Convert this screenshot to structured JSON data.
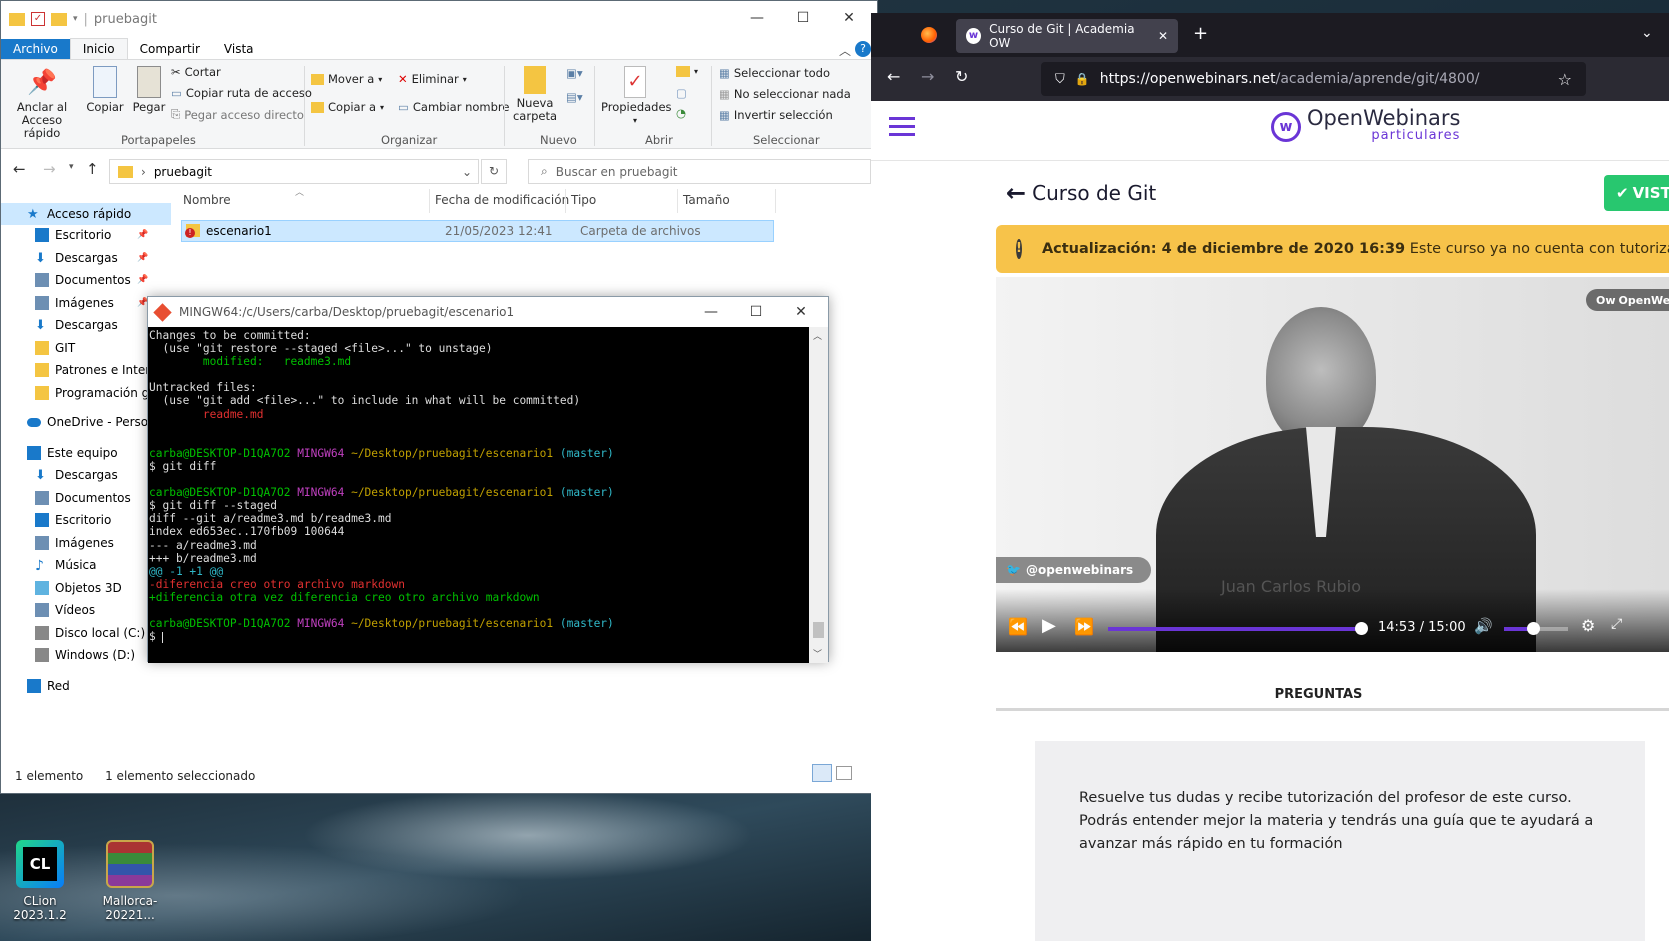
{
  "explorer": {
    "title": "pruebagit",
    "ribbon_tabs": [
      "Archivo",
      "Inicio",
      "Compartir",
      "Vista"
    ],
    "ribbon": {
      "pin": "Anclar al\nAcceso rápido",
      "pin_l1": "Anclar al",
      "pin_l2": "Acceso rápido",
      "copy": "Copiar",
      "paste": "Pegar",
      "cut": "Cortar",
      "copy_path": "Copiar ruta de acceso",
      "paste_shortcut": "Pegar acceso directo",
      "group_clipboard": "Portapapeles",
      "move_to": "Mover a",
      "copy_to": "Copiar a",
      "delete": "Eliminar",
      "rename": "Cambiar nombre",
      "group_organize": "Organizar",
      "new_folder_l1": "Nueva",
      "new_folder_l2": "carpeta",
      "group_new": "Nuevo",
      "properties": "Propiedades",
      "group_open": "Abrir",
      "select_all": "Seleccionar todo",
      "select_none": "No seleccionar nada",
      "invert_selection": "Invertir selección",
      "group_select": "Seleccionar"
    },
    "address": "pruebagit",
    "search_placeholder": "Buscar en pruebagit",
    "nav": {
      "quick_access": "Acceso rápido",
      "items_quick": [
        "Escritorio",
        "Descargas",
        "Documentos",
        "Imágenes",
        "Descargas",
        "GIT",
        "Patrones e Interfac",
        "Programación gen"
      ],
      "onedrive": "OneDrive - Personal",
      "this_pc": "Este equipo",
      "items_pc": [
        "Descargas",
        "Documentos",
        "Escritorio",
        "Imágenes",
        "Música",
        "Objetos 3D",
        "Vídeos",
        "Disco local (C:)",
        "Windows (D:)"
      ],
      "network": "Red"
    },
    "columns": [
      "Nombre",
      "Fecha de modificación",
      "Tipo",
      "Tamaño"
    ],
    "files": [
      {
        "name": "escenario1",
        "date": "21/05/2023 12:41",
        "type": "Carpeta de archivos",
        "size": ""
      }
    ],
    "status_count": "1 elemento",
    "status_selected": "1 elemento seleccionado"
  },
  "bash": {
    "title": "MINGW64:/c/Users/carba/Desktop/pruebagit/escenario1",
    "lines": [
      {
        "segs": [
          {
            "t": "Changes to be committed:",
            "c": ""
          }
        ]
      },
      {
        "segs": [
          {
            "t": "  (use \"git restore --staged <file>...\" to unstage)",
            "c": ""
          }
        ]
      },
      {
        "segs": [
          {
            "t": "        modified:   readme3.md",
            "c": "t-g"
          }
        ]
      },
      {
        "segs": [
          {
            "t": "",
            "c": ""
          }
        ]
      },
      {
        "segs": [
          {
            "t": "Untracked files:",
            "c": ""
          }
        ]
      },
      {
        "segs": [
          {
            "t": "  (use \"git add <file>...\" to include in what will be committed)",
            "c": ""
          }
        ]
      },
      {
        "segs": [
          {
            "t": "        readme.md",
            "c": "t-r"
          }
        ]
      },
      {
        "segs": [
          {
            "t": "",
            "c": ""
          }
        ]
      },
      {
        "segs": [
          {
            "t": "",
            "c": ""
          }
        ]
      },
      {
        "segs": [
          {
            "t": "carba@DESKTOP-D1QA7O2 ",
            "c": "t-g"
          },
          {
            "t": "MINGW64 ",
            "c": "t-m"
          },
          {
            "t": "~/Desktop/pruebagit/escenario1 ",
            "c": "t-y"
          },
          {
            "t": "(master)",
            "c": "t-c"
          }
        ]
      },
      {
        "segs": [
          {
            "t": "$ git diff",
            "c": ""
          }
        ]
      },
      {
        "segs": [
          {
            "t": "",
            "c": ""
          }
        ]
      },
      {
        "segs": [
          {
            "t": "carba@DESKTOP-D1QA7O2 ",
            "c": "t-g"
          },
          {
            "t": "MINGW64 ",
            "c": "t-m"
          },
          {
            "t": "~/Desktop/pruebagit/escenario1 ",
            "c": "t-y"
          },
          {
            "t": "(master)",
            "c": "t-c"
          }
        ]
      },
      {
        "segs": [
          {
            "t": "$ git diff --staged",
            "c": ""
          }
        ]
      },
      {
        "segs": [
          {
            "t": "diff --git a/readme3.md b/readme3.md",
            "c": ""
          }
        ]
      },
      {
        "segs": [
          {
            "t": "index ed653ec..170fb09 100644",
            "c": ""
          }
        ]
      },
      {
        "segs": [
          {
            "t": "--- a/readme3.md",
            "c": ""
          }
        ]
      },
      {
        "segs": [
          {
            "t": "+++ b/readme3.md",
            "c": ""
          }
        ]
      },
      {
        "segs": [
          {
            "t": "@@ -1 +1 @@",
            "c": "t-c"
          }
        ]
      },
      {
        "segs": [
          {
            "t": "-diferencia creo otro archivo markdown",
            "c": "t-r"
          }
        ]
      },
      {
        "segs": [
          {
            "t": "+diferencia otra vez diferencia creo otro archivo markdown",
            "c": "t-g"
          }
        ]
      },
      {
        "segs": [
          {
            "t": "",
            "c": ""
          }
        ]
      },
      {
        "segs": [
          {
            "t": "carba@DESKTOP-D1QA7O2 ",
            "c": "t-g"
          },
          {
            "t": "MINGW64 ",
            "c": "t-m"
          },
          {
            "t": "~/Desktop/pruebagit/escenario1 ",
            "c": "t-y"
          },
          {
            "t": "(master)",
            "c": "t-c"
          }
        ]
      },
      {
        "segs": [
          {
            "t": "$ ",
            "c": ""
          }
        ]
      }
    ]
  },
  "desktop": {
    "icons": [
      {
        "label": "CLion 2023.1.2",
        "color": "#23b37a"
      },
      {
        "label": "Mallorca-20221...",
        "color": "#8a3a9a"
      }
    ]
  },
  "browser": {
    "tab_title": "Curso de Git | Academia OW",
    "url_host": "https://openwebinars.net",
    "url_path": "/academia/aprende/git/4800/",
    "brand": "OpenWebinars",
    "brand_sub": "particulares",
    "course_title": "Curso de Git",
    "cta": "VIST",
    "alert_bold": "Actualización: 4 de diciembre de 2020 16:39",
    "alert_text": " Este curso ya no cuenta con tutorizació",
    "video": {
      "watermark": "OpenWebinars",
      "twitter": "@openwebinars",
      "speaker": "Juan Carlos Rubio",
      "time_current": "14:53",
      "time_sep": "/",
      "time_total": "15:00",
      "progress": 0.99,
      "volume": 0.45
    },
    "questions_heading": "PREGUNTAS",
    "questions_text_1": "Resuelve tus dudas y recibe tutorización del profesor de este curso.",
    "questions_text_2": "Podrás entender mejor la materia y tendrás una guía que te ayudará a",
    "questions_text_3": "avanzar más rápido en tu formación",
    "accent": "#6a35d6",
    "alert_color": "#f7c34a",
    "cta_color": "#28c76f"
  }
}
